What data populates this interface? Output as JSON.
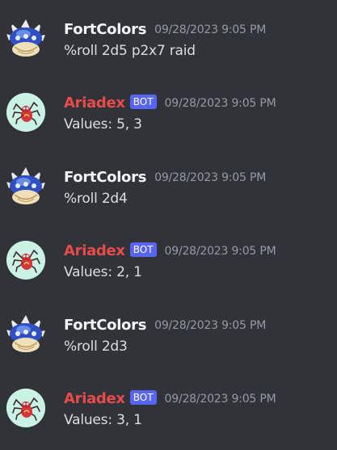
{
  "messages": [
    {
      "author": "FortColors",
      "is_bot": false,
      "timestamp": "09/28/2023 9:05 PM",
      "content": "%roll 2d5 p2x7 raid",
      "avatar_icon": "blue-spiny-shell-icon"
    },
    {
      "author": "Ariadex",
      "is_bot": true,
      "bot_tag": "BOT",
      "timestamp": "09/28/2023 9:05 PM",
      "content": "Values: 5, 3",
      "avatar_icon": "red-spider-icon"
    },
    {
      "author": "FortColors",
      "is_bot": false,
      "timestamp": "09/28/2023 9:05 PM",
      "content": "%roll 2d4",
      "avatar_icon": "blue-spiny-shell-icon"
    },
    {
      "author": "Ariadex",
      "is_bot": true,
      "bot_tag": "BOT",
      "timestamp": "09/28/2023 9:05 PM",
      "content": "Values: 2, 1",
      "avatar_icon": "red-spider-icon"
    },
    {
      "author": "FortColors",
      "is_bot": false,
      "timestamp": "09/28/2023 9:05 PM",
      "content": "%roll 2d3",
      "avatar_icon": "blue-spiny-shell-icon"
    },
    {
      "author": "Ariadex",
      "is_bot": true,
      "bot_tag": "BOT",
      "timestamp": "09/28/2023 9:05 PM",
      "content": "Values: 3, 1",
      "avatar_icon": "red-spider-icon"
    }
  ],
  "colors": {
    "background": "#313338",
    "user_name": "#f2f3f5",
    "bot_name": "#e94b4b",
    "bot_tag": "#5865f2",
    "timestamp": "#949ba4",
    "message_text": "#dbdee1"
  }
}
